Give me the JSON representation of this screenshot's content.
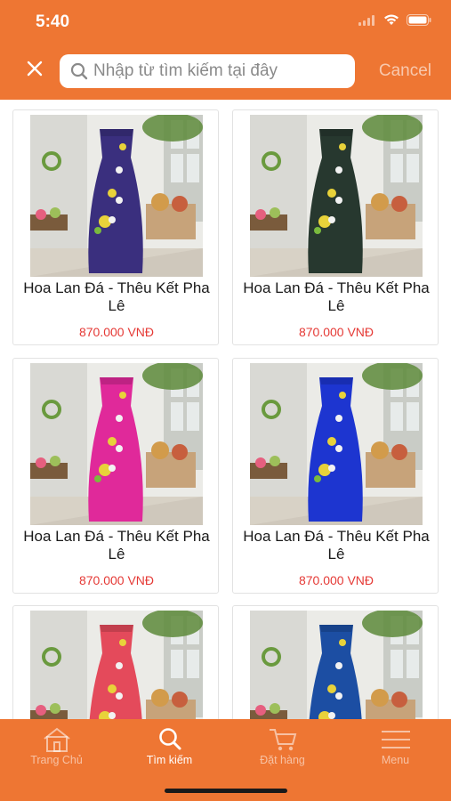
{
  "status_bar": {
    "time": "5:40"
  },
  "search": {
    "placeholder": "Nhập từ tìm kiếm tại đây",
    "value": "",
    "cancel_label": "Cancel"
  },
  "colors": {
    "brand": "#ee7633",
    "price": "#e53935",
    "active_tab_text": "#ffffff",
    "inactive_tab_text": "rgba(255,255,255,0.55)"
  },
  "products": [
    {
      "name": "Hoa Lan Đá - Thêu Kết Pha Lê",
      "price": "870.000 VNĐ",
      "dress_color": "#3a2f7e"
    },
    {
      "name": "Hoa Lan Đá - Thêu Kết Pha Lê",
      "price": "870.000 VNĐ",
      "dress_color": "#27382f"
    },
    {
      "name": "Hoa Lan Đá - Thêu Kết Pha Lê",
      "price": "870.000 VNĐ",
      "dress_color": "#e0299a"
    },
    {
      "name": "Hoa Lan Đá - Thêu Kết Pha Lê",
      "price": "870.000 VNĐ",
      "dress_color": "#1d35d0"
    },
    {
      "name": "",
      "price": "",
      "dress_color": "#e44a5b"
    },
    {
      "name": "",
      "price": "",
      "dress_color": "#1c4ea3"
    }
  ],
  "tabbar": {
    "tabs": [
      {
        "label": "Trang Chủ",
        "icon": "home-icon",
        "active": false
      },
      {
        "label": "Tìm kiếm",
        "icon": "search-icon",
        "active": true
      },
      {
        "label": "Đặt hàng",
        "icon": "cart-icon",
        "active": false
      },
      {
        "label": "Menu",
        "icon": "menu-icon",
        "active": false
      }
    ]
  }
}
